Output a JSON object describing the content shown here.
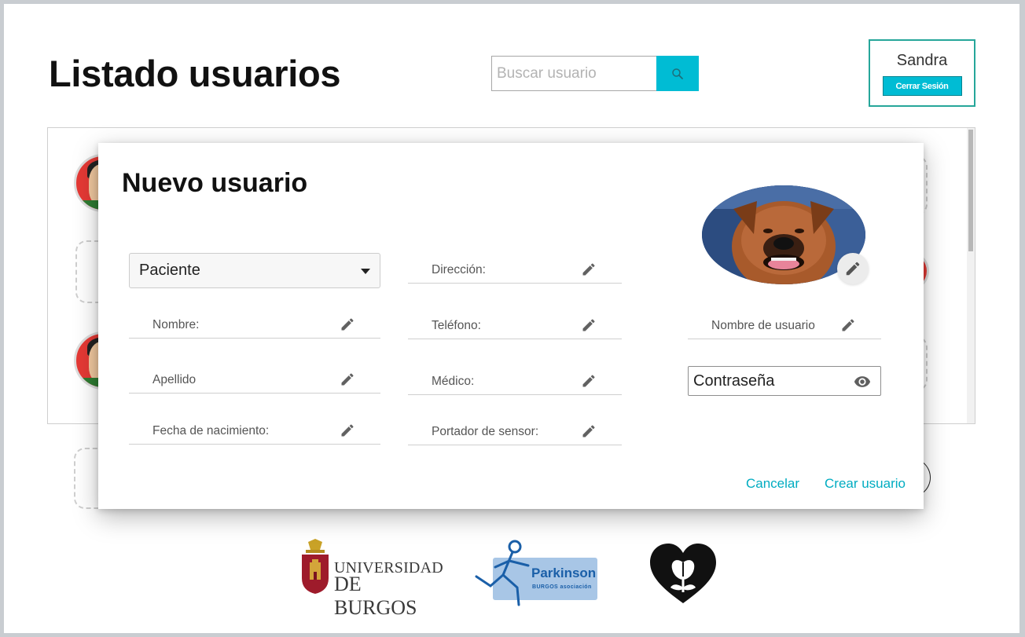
{
  "header": {
    "title": "Listado usuarios",
    "search_placeholder": "Buscar usuario",
    "search_icon": "search-icon"
  },
  "user": {
    "name": "Sandra",
    "logout_label": "Cerrar Sesión"
  },
  "modal": {
    "title": "Nuevo usuario",
    "user_type": "Paciente",
    "fields_left": [
      "Nombre:",
      "Apellido",
      "Fecha de nacimiento:"
    ],
    "fields_middle": [
      "Dirección:",
      "Teléfono:",
      "Médico:",
      "Portador de sensor:"
    ],
    "username_label": "Nombre de usuario",
    "password_placeholder": "Contraseña",
    "cancel_label": "Cancelar",
    "create_label": "Crear usuario",
    "edit_icon": "pencil-icon",
    "visibility_icon": "eye-icon"
  },
  "footer": {
    "university_line1": "UNIVERSIDAD",
    "university_line2": "DE BURGOS",
    "parkinson_word": "Parkinson",
    "parkinson_sub": "BURGOS asociación"
  },
  "colors": {
    "accent": "#00bcd4",
    "accent_text": "#00acc1",
    "user_box_border": "#26a69a"
  }
}
